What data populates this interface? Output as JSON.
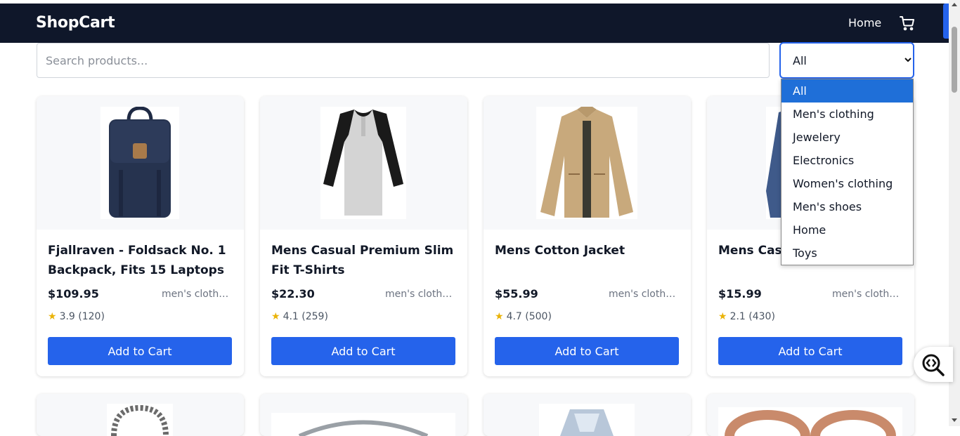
{
  "header": {
    "brand": "ShopCart",
    "home_label": "Home",
    "cart_icon": "cart-icon"
  },
  "search": {
    "placeholder": "Search products..."
  },
  "category_select": {
    "selected": "All",
    "options": [
      "All",
      "Men's clothing",
      "Jewelery",
      "Electronics",
      "Women's clothing",
      "Men's shoes",
      "Home",
      "Toys"
    ]
  },
  "products": [
    {
      "title": "Fjallraven - Foldsack No. 1 Backpack, Fits 15 Laptops",
      "price": "$109.95",
      "category": "men's clothing",
      "rating": "3.9 (120)",
      "button": "Add to Cart"
    },
    {
      "title": "Mens Casual Premium Slim Fit T-Shirts",
      "price": "$22.30",
      "category": "men's clothing",
      "rating": "4.1 (259)",
      "button": "Add to Cart"
    },
    {
      "title": "Mens Cotton Jacket",
      "price": "$55.99",
      "category": "men's clothing",
      "rating": "4.7 (500)",
      "button": "Add to Cart"
    },
    {
      "title": "Mens Cas",
      "price": "$15.99",
      "category": "men's clothing",
      "rating": "2.1 (430)",
      "button": "Add to Cart"
    }
  ],
  "colors": {
    "navbar": "#0f172a",
    "accent": "#2563eb",
    "star": "#eab308"
  }
}
